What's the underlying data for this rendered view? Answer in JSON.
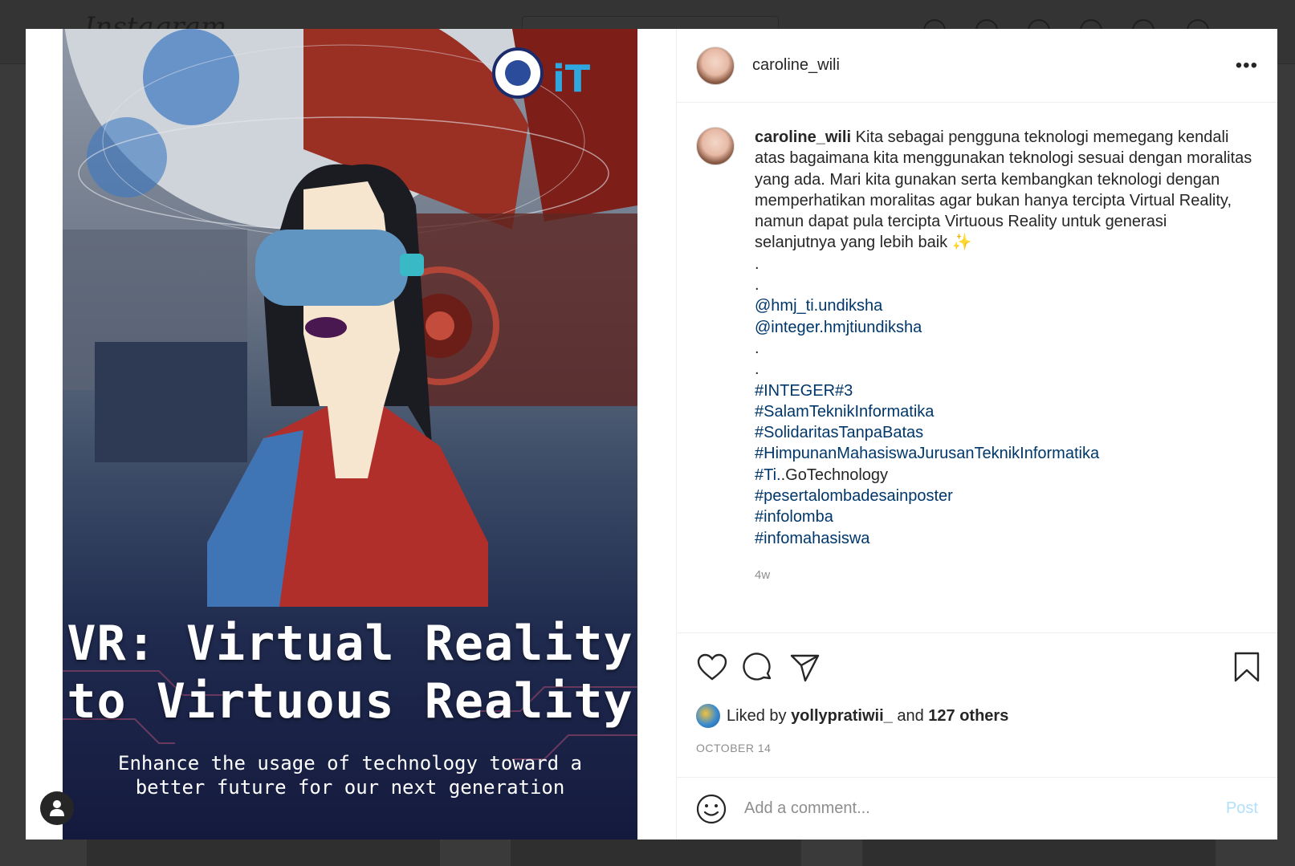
{
  "background": {
    "logo": "Instagram"
  },
  "post": {
    "poster": {
      "title_line1": "VR: Virtual Reality",
      "title_line2": "to Virtuous Reality",
      "subtitle_line1": "Enhance the usage of technology toward a",
      "subtitle_line2": "better future for our next generation"
    },
    "header": {
      "username": "caroline_wili",
      "more_label": "•••"
    },
    "caption": {
      "username": "caroline_wili",
      "text": "Kita sebagai pengguna teknologi memegang kendali atas bagaimana kita menggunakan teknologi sesuai dengan moralitas yang ada. Mari kita gunakan serta kembangkan teknologi dengan memperhatikan moralitas agar bukan hanya tercipta Virtual Reality, namun dapat pula tercipta Virtuous Reality untuk generasi selanjutnya yang lebih baik ✨",
      "dot1": ".",
      "dot2": ".",
      "mention1": "@hmj_ti.undiksha",
      "mention2": "@integer.hmjtiundiksha",
      "dot3": ".",
      "dot4": ".",
      "hashtag1": "#INTEGER#3",
      "hashtag2": "#SalamTeknikInformatika",
      "hashtag3": "#SolidaritasTanpaBatas",
      "hashtag4": "#HimpunanMahasiswaJurusanTeknikInformatika",
      "hashtag5_prefix": "#Ti.",
      "hashtag5_rest": ".GoTechnology",
      "hashtag6": "#pesertalombadesainposter",
      "hashtag7": "#infolomba",
      "hashtag8": "#infomahasiswa",
      "time_ago": "4w"
    },
    "likes": {
      "prefix": "Liked by",
      "liker": "yollypratiwii_",
      "and": "and",
      "others": "127 others"
    },
    "date": "OCTOBER 14",
    "comment": {
      "placeholder": "Add a comment...",
      "post_label": "Post"
    }
  },
  "colors": {
    "link": "#00376b",
    "post_button_disabled": "#b2dffc",
    "muted": "#8e8e8e"
  }
}
